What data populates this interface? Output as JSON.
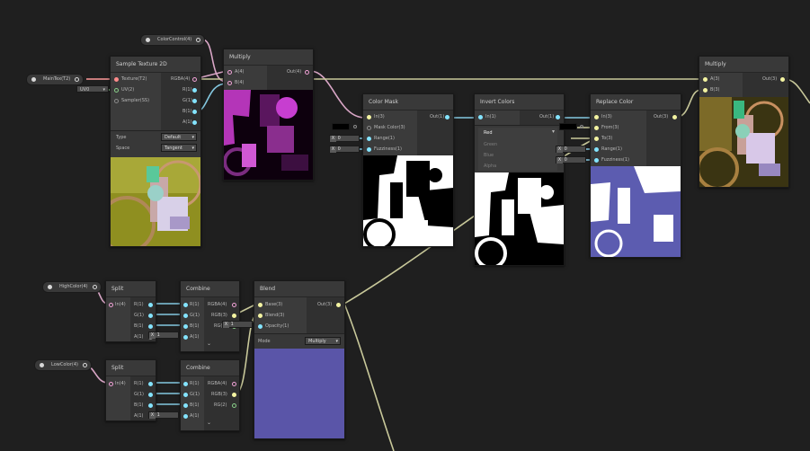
{
  "properties": {
    "color_control": "ColorControl(4)",
    "main_tex": "MainTex(T2)",
    "high_color": "HighColor(4)",
    "low_color": "LowColor(4)",
    "uv_value": "UV0"
  },
  "sample_texture": {
    "title": "Sample Texture 2D",
    "inputs": [
      "Texture(T2)",
      "UV(2)",
      "Sampler(SS)"
    ],
    "outputs": [
      "RGBA(4)",
      "R(1)",
      "G(1)",
      "B(1)",
      "A(1)"
    ],
    "type_label": "Type",
    "type_value": "Default",
    "space_label": "Space",
    "space_value": "Tangent"
  },
  "multiply1": {
    "title": "Multiply",
    "inputs": [
      "A(4)",
      "B(4)"
    ],
    "output": "Out(4)"
  },
  "color_mask": {
    "title": "Color Mask",
    "inputs": [
      "In(3)",
      "Mask Color(3)",
      "Range(1)",
      "Fuzziness(1)"
    ],
    "output": "Out(1)",
    "range_value": "0",
    "fuzz_value": "0",
    "x_label": "X"
  },
  "invert_colors": {
    "title": "Invert Colors",
    "input": "In(1)",
    "output": "Out(1)",
    "options": [
      "Red",
      "Green",
      "Blue",
      "Alpha"
    ]
  },
  "replace_color": {
    "title": "Replace Color",
    "inputs": [
      "In(3)",
      "From(3)",
      "To(3)",
      "Range(1)",
      "Fuzziness(1)"
    ],
    "output": "Out(3)",
    "range_value": "0",
    "fuzz_value": "0"
  },
  "multiply2": {
    "title": "Multiply",
    "inputs": [
      "A(3)",
      "B(3)"
    ],
    "output": "Out(3)"
  },
  "split1": {
    "title": "Split",
    "input": "In(4)",
    "outputs": [
      "R(1)",
      "G(1)",
      "B(1)",
      "A(1)"
    ]
  },
  "split2": {
    "title": "Split",
    "input": "In(4)",
    "outputs": [
      "R(1)",
      "G(1)",
      "B(1)",
      "A(1)"
    ]
  },
  "combine1": {
    "title": "Combine",
    "inputs": [
      "R(1)",
      "G(1)",
      "B(1)",
      "A(1)"
    ],
    "outputs": [
      "RGBA(4)",
      "RGB(3)",
      "RG(2)"
    ],
    "a_value": "1",
    "x_label": "X"
  },
  "combine2": {
    "title": "Combine",
    "inputs": [
      "R(1)",
      "G(1)",
      "B(1)",
      "A(1)"
    ],
    "outputs": [
      "RGBA(4)",
      "RGB(3)",
      "RG(2)"
    ],
    "a_value": "1",
    "x_label": "X"
  },
  "blend": {
    "title": "Blend",
    "inputs": [
      "Base(3)",
      "Blend(3)",
      "Opacity(1)"
    ],
    "output": "Out(3)",
    "opacity_value": "1",
    "mode_label": "Mode",
    "mode_value": "Multiply",
    "x_label": "X"
  },
  "colors": {
    "canvas": "#1f1f1f",
    "wire_vec3": "#c8c89a",
    "wire_vec4": "#d9a6c6",
    "wire_vec1": "#84c8e0",
    "blend_preview": "#5a55a8",
    "replace_preview": "#5c5cb0",
    "magenta": "#c73ed0"
  }
}
